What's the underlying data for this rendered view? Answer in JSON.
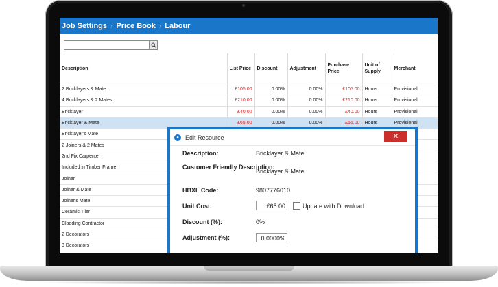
{
  "breadcrumb": [
    "Job Settings",
    "Price Book",
    "Labour"
  ],
  "search": {
    "placeholder": "",
    "value": ""
  },
  "columns": [
    "Description",
    "List Price",
    "Discount",
    "Adjustment",
    "Purchase Price",
    "Unit of Supply",
    "Merchant"
  ],
  "rows": [
    {
      "description": "2 Bricklayers & Mate",
      "list_price": "£105.00",
      "discount": "0.00%",
      "adjustment": "0.00%",
      "purchase_price": "£105.00",
      "unit": "Hours",
      "merchant": "Provisional"
    },
    {
      "description": "4 Bricklayers & 2 Mates",
      "list_price": "£210.00",
      "discount": "0.00%",
      "adjustment": "0.00%",
      "purchase_price": "£210.00",
      "unit": "Hours",
      "merchant": "Provisional"
    },
    {
      "description": "Bricklayer",
      "list_price": "£40.00",
      "discount": "0.00%",
      "adjustment": "0.00%",
      "purchase_price": "£40.00",
      "unit": "Hours",
      "merchant": "Provisional"
    },
    {
      "description": "Bricklayer & Mate",
      "list_price": "£65.00",
      "discount": "0.00%",
      "adjustment": "0.00%",
      "purchase_price": "£65.00",
      "unit": "Hours",
      "merchant": "Provisional"
    },
    {
      "description": "Bricklayer's Mate"
    },
    {
      "description": "2 Joiners & 2 Mates"
    },
    {
      "description": "2nd Fix Carpenter"
    },
    {
      "description": "Included in Timber Frame"
    },
    {
      "description": "Joiner"
    },
    {
      "description": "Joiner & Mate"
    },
    {
      "description": "Joiner's Mate"
    },
    {
      "description": "Ceramic Tiler"
    },
    {
      "description": "Cladding Contractor"
    },
    {
      "description": "2 Decorators"
    },
    {
      "description": "3 Decorators"
    }
  ],
  "selected_row": 3,
  "dialog": {
    "title": "Edit Resource",
    "close_glyph": "✕",
    "description_label": "Description:",
    "description_value": "Bricklayer & Mate",
    "customer_label": "Customer Friendly Description:",
    "customer_value": "Bricklayer & Mate",
    "hbxl_label": "HBXL Code:",
    "hbxl_value": "9807776010",
    "unit_cost_label": "Unit Cost:",
    "unit_cost_value": "£65.00",
    "update_label": "Update with Download",
    "discount_label": "Discount (%):",
    "discount_value": "0%",
    "adjustment_label": "Adjustment (%):",
    "adjustment_value": "0.0000%"
  },
  "colors": {
    "accent": "#1a76c9",
    "price_red": "#d12b2b",
    "selected_row": "#cfe2f3",
    "close_red": "#c9302c"
  }
}
